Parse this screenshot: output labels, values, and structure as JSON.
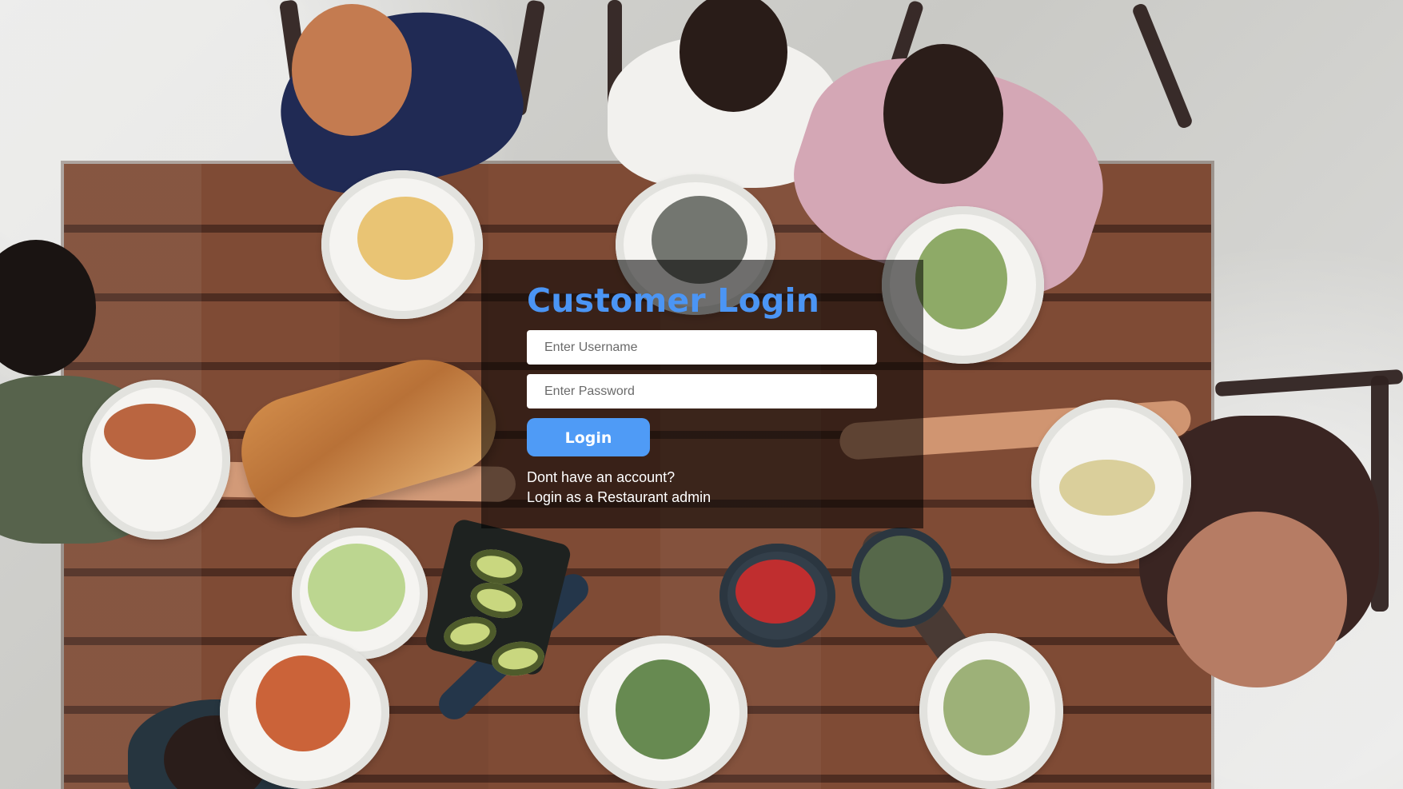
{
  "login": {
    "title": "Customer Login",
    "username_placeholder": "Enter Username",
    "password_placeholder": "Enter Password",
    "button_label": "Login",
    "signup_text": "Dont have an account?",
    "admin_text": "Login as a Restaurant admin"
  },
  "colors": {
    "title": "#4b95f4",
    "button": "#4f9bf6",
    "overlay": "rgba(0, 0, 0, 0.55)"
  }
}
